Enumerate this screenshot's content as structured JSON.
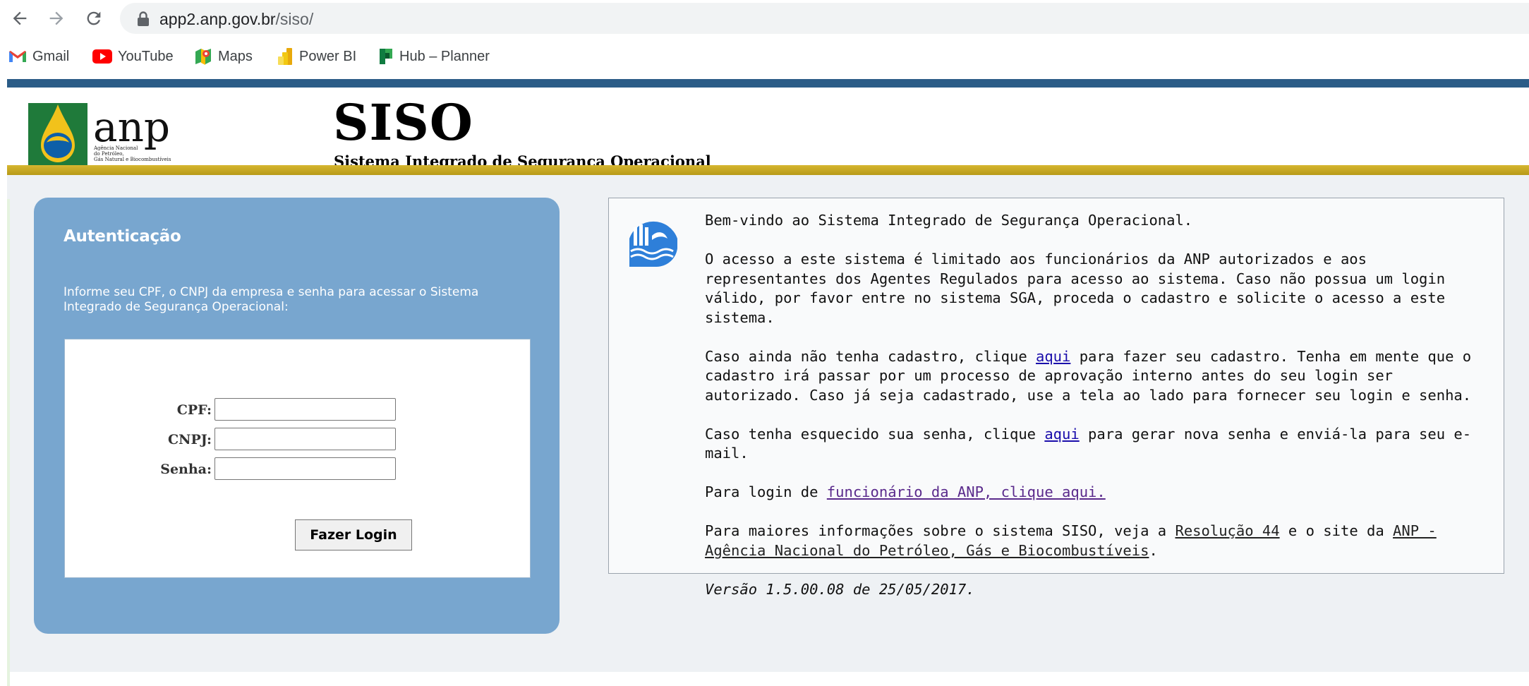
{
  "browser": {
    "url_host": "app2.anp.gov.br",
    "url_path": "/siso/",
    "bookmarks": [
      {
        "label": "Gmail",
        "icon": "gmail-icon"
      },
      {
        "label": "YouTube",
        "icon": "youtube-icon"
      },
      {
        "label": "Maps",
        "icon": "maps-icon"
      },
      {
        "label": "Power BI",
        "icon": "powerbi-icon"
      },
      {
        "label": "Hub – Planner",
        "icon": "planner-icon"
      }
    ]
  },
  "header": {
    "logo_text": "anp",
    "logo_caption": "Agência Nacional do Petróleo, Gás Natural e Biocombustíveis",
    "title": "SISO",
    "subtitle": "Sistema Integrado de Segurança Operacional"
  },
  "auth": {
    "title": "Autenticação",
    "description": "Informe seu CPF, o CNPJ da empresa e senha para acessar o Sistema Integrado de Segurança Operacional:",
    "cpf_label": "CPF:",
    "cnpj_label": "CNPJ:",
    "senha_label": "Senha:",
    "cpf_value": "",
    "cnpj_value": "",
    "senha_value": "",
    "login_button": "Fazer Login"
  },
  "info": {
    "welcome": "Bem-vindo ao Sistema Integrado de Segurança Operacional.",
    "access": "O acesso a este sistema é limitado aos funcionários da ANP autorizados e aos representantes dos Agentes Regulados para acesso ao sistema. Caso não possua um login válido, por favor entre no sistema SGA, proceda o cadastro e solicite o acesso a este sistema.",
    "signup_pre": "Caso ainda não tenha cadastro, clique ",
    "signup_link": "aqui",
    "signup_post": " para fazer seu cadastro. Tenha em mente que o cadastro irá passar por um processo de aprovação interno antes do seu login ser autorizado. Caso já seja cadastrado, use a tela ao lado para fornecer seu login e senha.",
    "forgot_pre": "Caso tenha esquecido sua senha, clique ",
    "forgot_link": "aqui",
    "forgot_post": " para gerar nova senha e enviá-la para seu e-mail.",
    "employee_pre": "Para login de ",
    "employee_link": "funcionário da ANP, clique aqui.",
    "more_pre": "Para maiores informações sobre o sistema SISO, veja a ",
    "more_link1": "Resolução 44",
    "more_mid": " e o site da ",
    "more_link2": "ANP - Agência Nacional do Petróleo, Gás e Biocombustíveis",
    "more_post": ".",
    "version": "Versão 1.5.00.08 de 25/05/2017."
  }
}
